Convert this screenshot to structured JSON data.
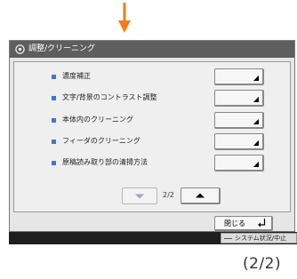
{
  "colors": {
    "accent_arrow": "#f07c1c",
    "bullet": "#3f78c8",
    "titlebar": "#5e5e5e",
    "statusbar": "#1e1e1e"
  },
  "window": {
    "title": "調整/クリーニング",
    "icon": "wrench-icon"
  },
  "items": [
    {
      "label": "濃度補正"
    },
    {
      "label": "文字/背景のコントラスト調整"
    },
    {
      "label": "本体内のクリーニング"
    },
    {
      "label": "フィーダのクリーニング"
    },
    {
      "label": "原稿読み取り部の清掃方法"
    }
  ],
  "pager": {
    "indicator": "2/2",
    "prev_icon": "triangle-down-icon",
    "next_icon": "triangle-up-icon"
  },
  "footer": {
    "close_label": "閉じる",
    "close_icon": "enter-icon"
  },
  "status": {
    "button_label": "システム状況/中止"
  },
  "page_number": "(2/2)"
}
